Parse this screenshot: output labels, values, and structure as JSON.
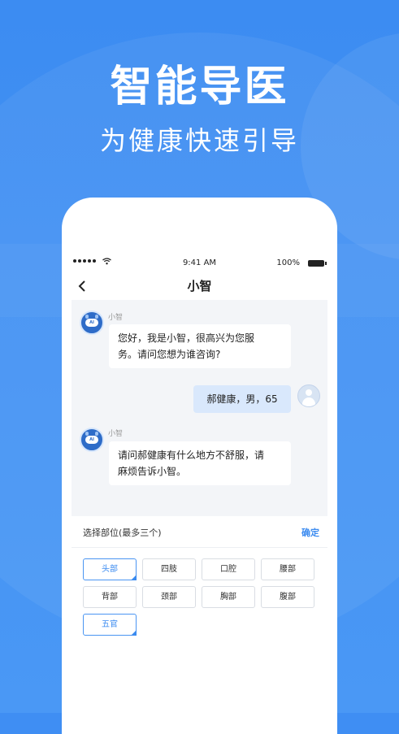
{
  "banner": {
    "title": "智能导医",
    "subtitle": "为健康快速引导"
  },
  "status_bar": {
    "time": "9:41 AM",
    "battery": "100%"
  },
  "nav": {
    "title": "小智"
  },
  "chat": {
    "bot_name": "小智",
    "messages": [
      {
        "from": "bot",
        "line1": "您好，我是小智，很高兴为您服",
        "line2": "务。请问您想为谁咨询?"
      },
      {
        "from": "user",
        "text": "郝健康，男，65"
      },
      {
        "from": "bot",
        "line1": "请问郝健康有什么地方不舒服，请",
        "line2": "麻烦告诉小智。"
      }
    ]
  },
  "picker": {
    "title": "选择部位(最多三个)",
    "confirm_label": "确定",
    "options": [
      {
        "label": "头部",
        "selected": true
      },
      {
        "label": "四肢",
        "selected": false
      },
      {
        "label": "口腔",
        "selected": false
      },
      {
        "label": "腰部",
        "selected": false
      },
      {
        "label": "背部",
        "selected": false
      },
      {
        "label": "颈部",
        "selected": false
      },
      {
        "label": "胸部",
        "selected": false
      },
      {
        "label": "腹部",
        "selected": false
      },
      {
        "label": "五官",
        "selected": true
      }
    ]
  },
  "colors": {
    "background": "#3c8cf2",
    "accent": "#3b8bf0",
    "user_bubble": "#d9e8fc"
  }
}
